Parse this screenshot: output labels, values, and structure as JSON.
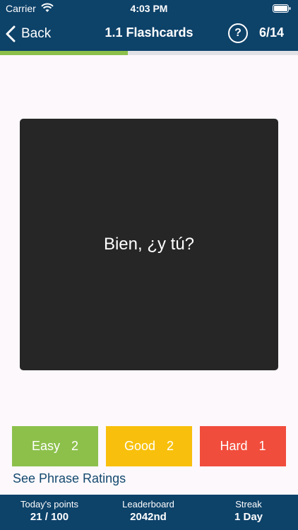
{
  "status_bar": {
    "carrier": "Carrier",
    "time": "4:03 PM"
  },
  "nav": {
    "back_label": "Back",
    "title": "1.1 Flashcards",
    "help_label": "?",
    "counter": "6/14"
  },
  "progress": {
    "current": 6,
    "total": 14,
    "fraction": 0.43
  },
  "card": {
    "text": "Bien, ¿y tú?"
  },
  "ratings": {
    "easy": {
      "label": "Easy",
      "count": "2"
    },
    "good": {
      "label": "Good",
      "count": "2"
    },
    "hard": {
      "label": "Hard",
      "count": "1"
    }
  },
  "see_ratings_label": "See Phrase Ratings",
  "footer": {
    "points_label": "Today's points",
    "points_value": "21 / 100",
    "leaderboard_label": "Leaderboard",
    "leaderboard_value": "2042nd",
    "streak_label": "Streak",
    "streak_value": "1 Day"
  },
  "colors": {
    "header_bg": "#0d4269",
    "easy": "#8cc04b",
    "good": "#f8c00c",
    "hard": "#f14d3c",
    "card_bg": "#262626",
    "page_bg": "#fcf8fc"
  },
  "icons": [
    "wifi-icon",
    "battery-icon",
    "back-chevron-icon",
    "help-icon"
  ]
}
